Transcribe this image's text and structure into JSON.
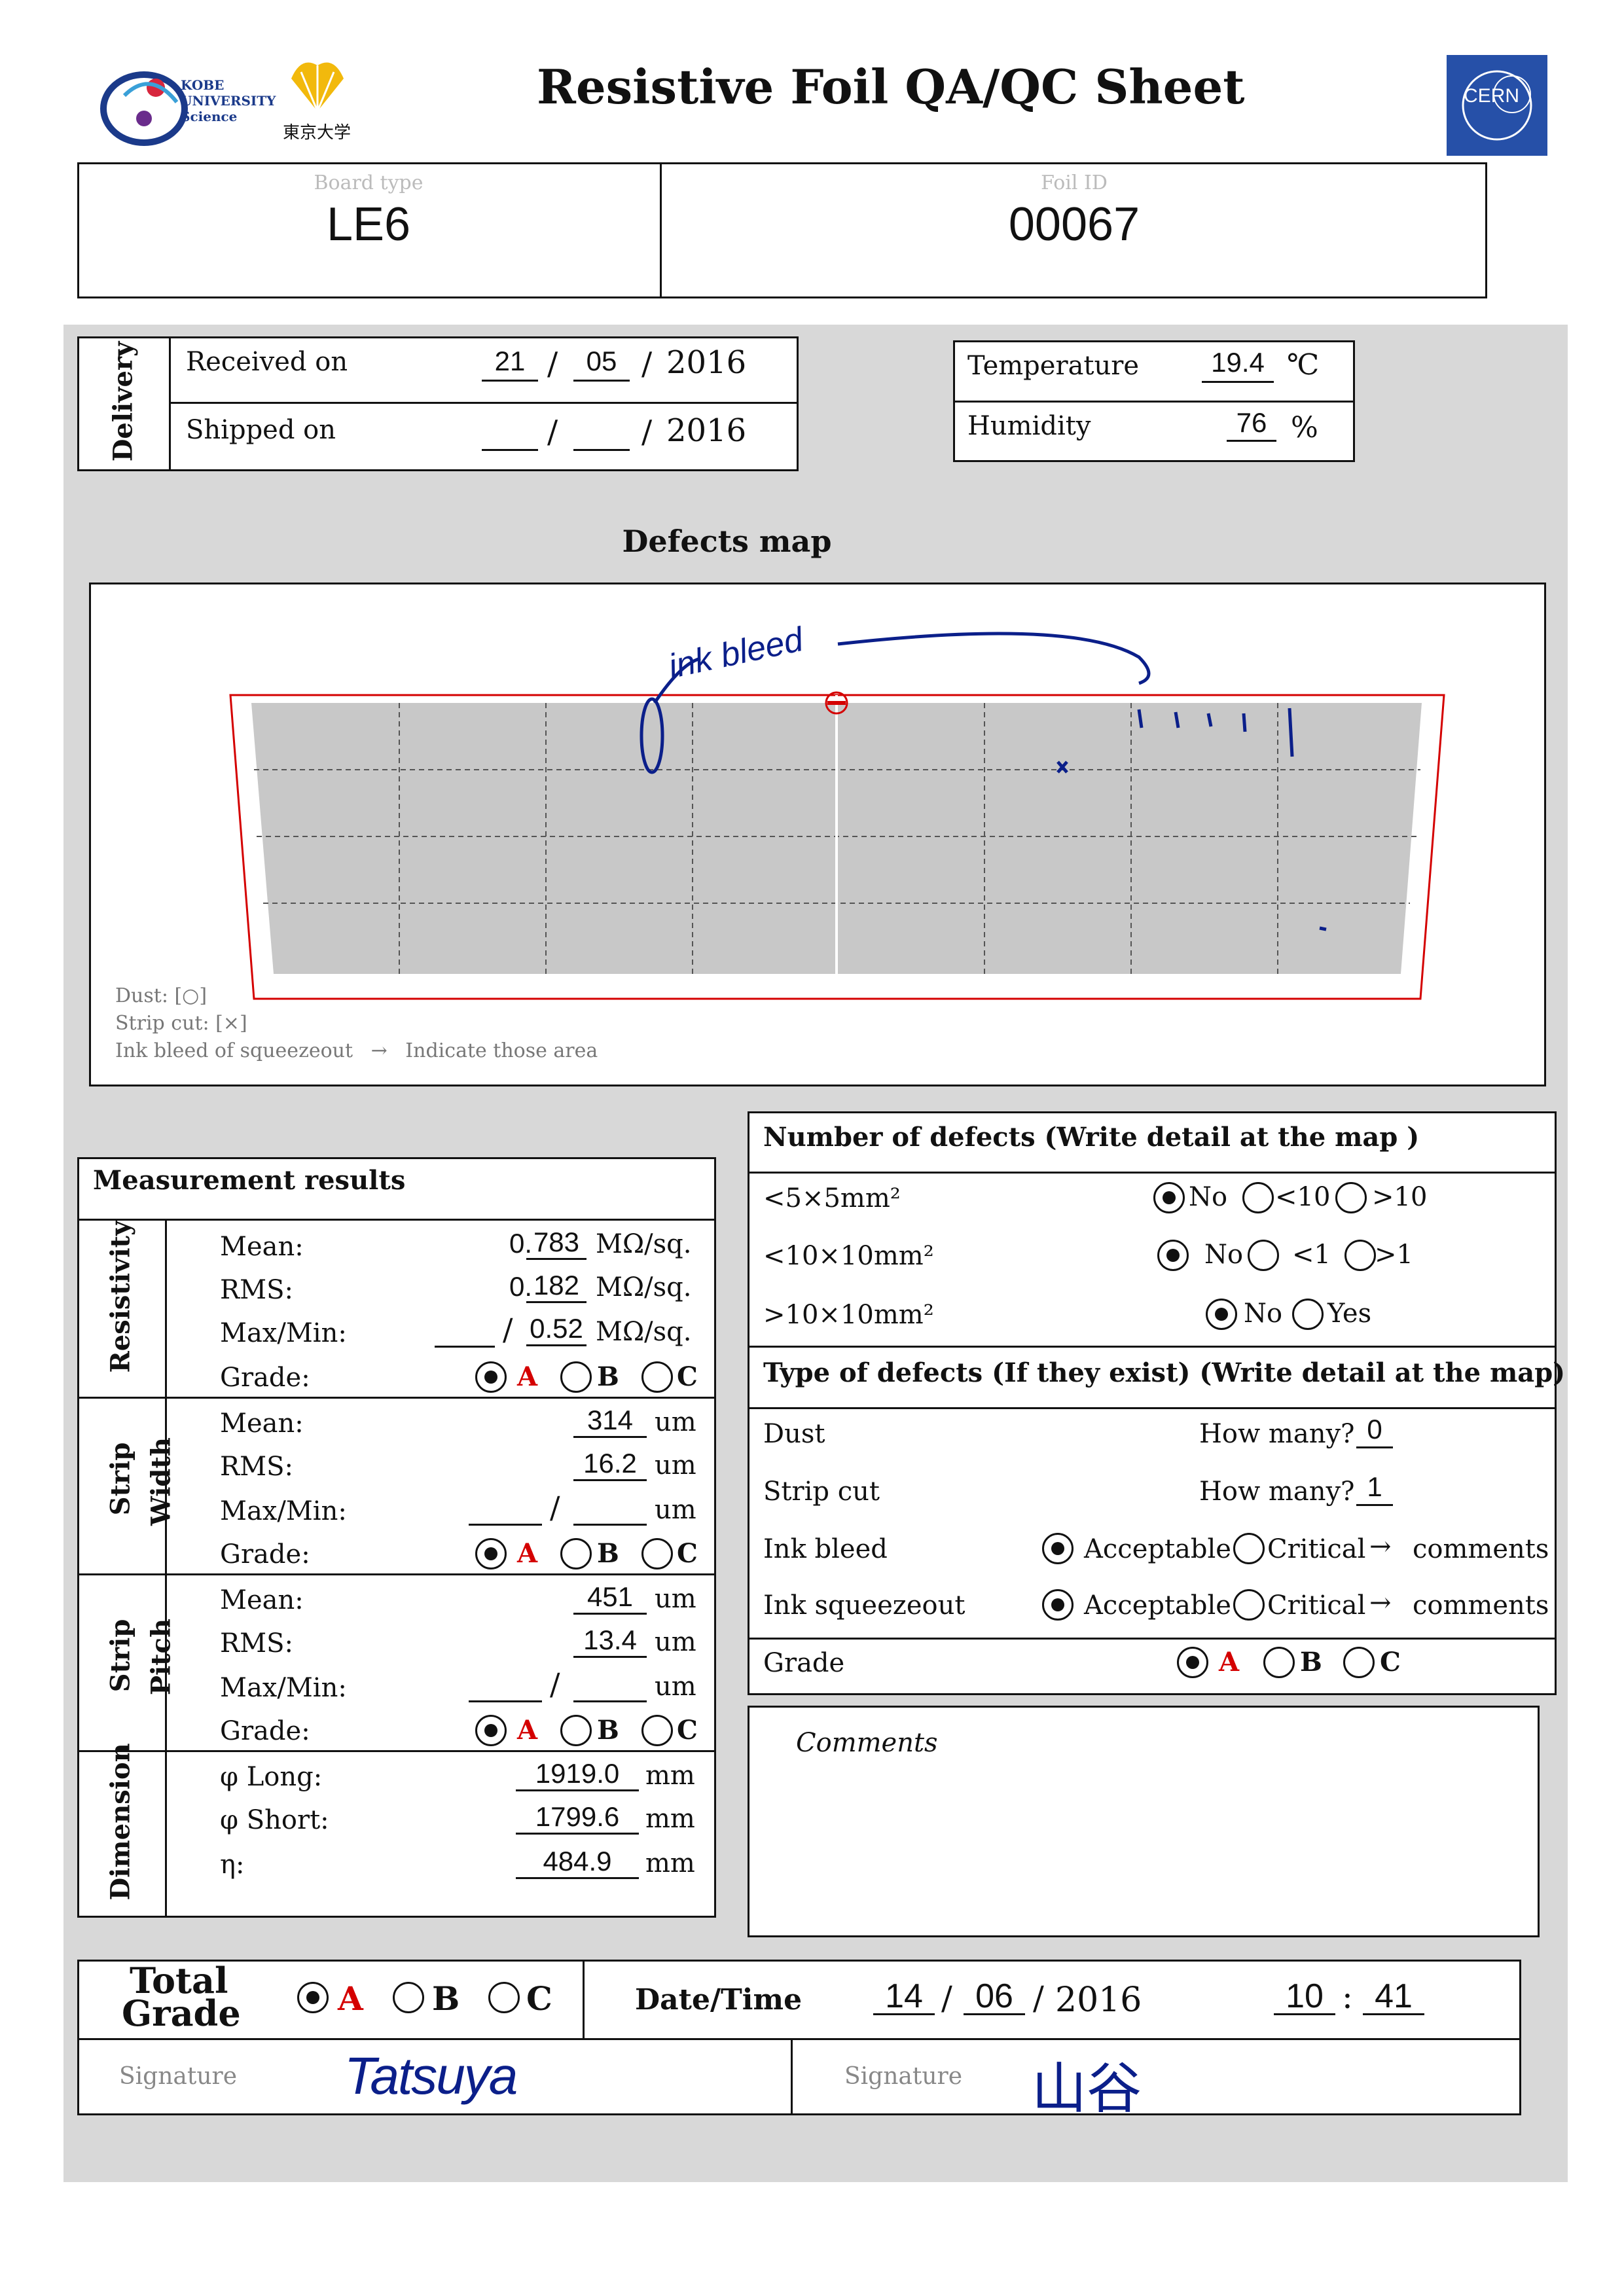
{
  "header": {
    "title": "Resistive Foil QA/QC Sheet",
    "logo_kobe": "KOBE UNIVERSITY Science",
    "logo_tokyo": "東京大学",
    "logo_cern": "CERN"
  },
  "board": {
    "board_type_label": "Board type",
    "board_type_value": "LE6",
    "foil_id_label": "Foil ID",
    "foil_id_value": "00067"
  },
  "delivery": {
    "section_label": "Delivery",
    "received_label": "Received on",
    "received_day": "21",
    "received_month": "05",
    "received_year": "2016",
    "shipped_label": "Shipped on",
    "shipped_day": "",
    "shipped_month": "",
    "shipped_year": "2016",
    "slash": "/"
  },
  "environment": {
    "temperature_label": "Temperature",
    "temperature_value": "19.4",
    "temperature_unit": "℃",
    "humidity_label": "Humidity",
    "humidity_value": "76",
    "humidity_unit": "%"
  },
  "defects_map": {
    "title": "Defects map",
    "annotation": "ink bleed",
    "legend_dust": "Dust: [○]",
    "legend_strip_cut": "Strip cut: [×]",
    "legend_ink": "Ink bleed of squeezeout",
    "legend_arrow": "→",
    "legend_indicate": "Indicate those area"
  },
  "measurement": {
    "title": "Measurement results",
    "resistivity": {
      "section_label": "Resistivity",
      "mean_label": "Mean:",
      "mean_prefix": "0.",
      "mean_value": "783",
      "unit": "MΩ/sq.",
      "rms_label": "RMS:",
      "rms_prefix": "0.",
      "rms_value": "182",
      "maxmin_label": "Max/Min:",
      "max_value": "",
      "min_value": "0.52",
      "grade_label": "Grade:"
    },
    "strip_width": {
      "section_label_1": "Strip",
      "section_label_2": "Width",
      "mean_label": "Mean:",
      "mean_value": "314",
      "unit": "um",
      "rms_label": "RMS:",
      "rms_value": "16.2",
      "maxmin_label": "Max/Min:",
      "max_value": "",
      "min_value": "",
      "grade_label": "Grade:"
    },
    "strip_pitch": {
      "section_label_1": "Strip",
      "section_label_2": "Pitch",
      "mean_label": "Mean:",
      "mean_value": "451",
      "unit": "um",
      "rms_label": "RMS:",
      "rms_value": "13.4",
      "maxmin_label": "Max/Min:",
      "max_value": "",
      "min_value": "",
      "grade_label": "Grade:"
    },
    "dimension": {
      "section_label": "Dimension",
      "long_label": "φ Long:",
      "long_value": "1919.0",
      "short_label": "φ Short:",
      "short_value": "1799.6",
      "eta_label": "η:",
      "eta_value": "484.9",
      "unit": "mm"
    },
    "grade_a": "A",
    "grade_b": "B",
    "grade_c": "C"
  },
  "defects_count": {
    "title": "Number of defects (Write detail at the map )",
    "row1_label": "<5×5mm²",
    "row1_opt1": "No",
    "row1_opt2": "<10",
    "row1_opt3": ">10",
    "row2_label": "<10×10mm²",
    "row2_opt1": "No",
    "row2_opt2": "<1",
    "row2_opt3": ">1",
    "row3_label": ">10×10mm²",
    "row3_opt1": "No",
    "row3_opt2": "Yes"
  },
  "defect_types": {
    "title": "Type of defects (If they exist) (Write detail at the map)",
    "dust_label": "Dust",
    "dust_q": "How many?",
    "dust_value": "0",
    "cut_label": "Strip cut",
    "cut_q": "How many?",
    "cut_value": "1",
    "ink_label": "Ink bleed",
    "squeeze_label": "Ink squeezeout",
    "acceptable": "Acceptable",
    "critical": "Critical",
    "arrow": "→",
    "comments": "comments",
    "grade_label": "Grade",
    "grade_a": "A",
    "grade_b": "B",
    "grade_c": "C"
  },
  "comments": {
    "title": "Comments"
  },
  "total": {
    "label_1": "Total",
    "label_2": "Grade",
    "grade_a": "A",
    "grade_b": "B",
    "grade_c": "C",
    "datetime_label": "Date/Time",
    "day": "14",
    "month": "06",
    "year": "2016",
    "hour": "10",
    "minute": "41",
    "colon": ":",
    "signature_label_1": "Signature",
    "signature_1": "Tatsuya",
    "signature_label_2": "Signature",
    "signature_2": "山谷"
  }
}
